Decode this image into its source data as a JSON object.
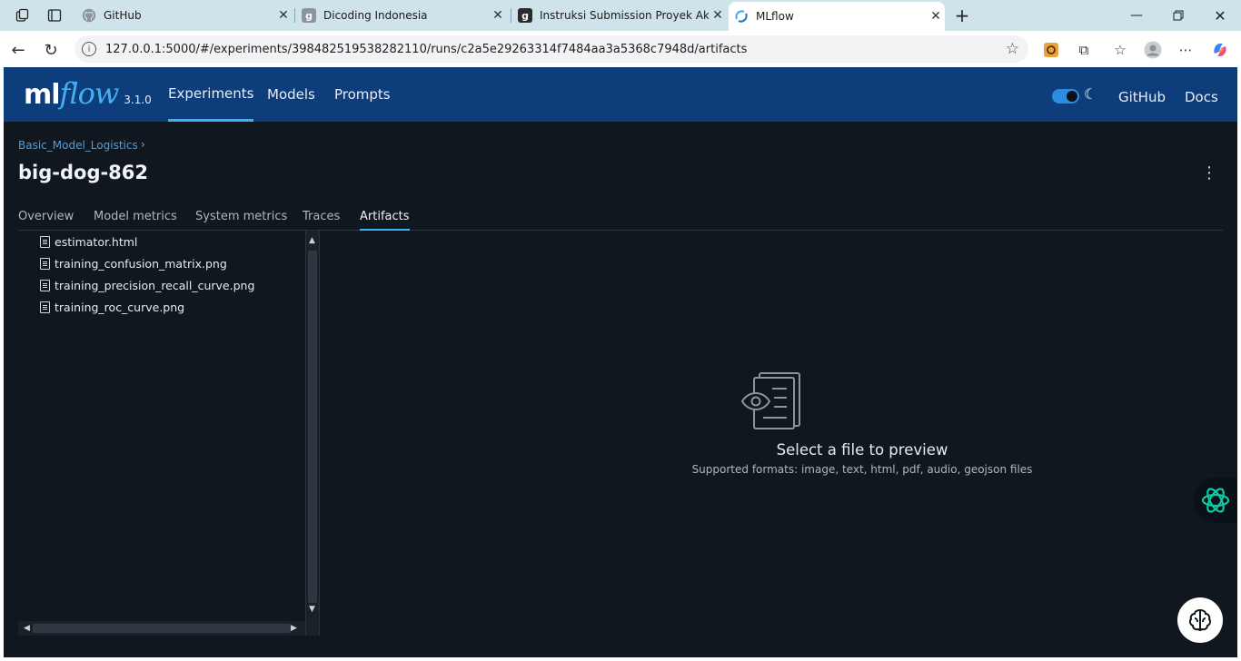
{
  "browser": {
    "tabs": [
      {
        "title": "GitHub",
        "favicon": "github-icon"
      },
      {
        "title": "Dicoding Indonesia",
        "favicon": "dicoding-icon"
      },
      {
        "title": "Instruksi Submission Proyek Akhir",
        "favicon": "dicoding-icon"
      },
      {
        "title": "MLflow",
        "favicon": "mlflow-icon",
        "active": true
      }
    ],
    "url": "127.0.0.1:5000/#/experiments/398482519538282110/runs/c2a5e29263314f7484aa3a5368c7948d/artifacts"
  },
  "app": {
    "logo_ml": "ml",
    "logo_flow": "flow",
    "version": "3.1.0",
    "nav": [
      "Experiments",
      "Models",
      "Prompts"
    ],
    "active_nav": "Experiments",
    "header_links": [
      "GitHub",
      "Docs"
    ],
    "dark_mode": true
  },
  "run": {
    "breadcrumb": "Basic_Model_Logistics",
    "breadcrumb_sep": "›",
    "title": "big-dog-862",
    "tabs": [
      "Overview",
      "Model metrics",
      "System metrics",
      "Traces",
      "Artifacts"
    ],
    "active_tab": "Artifacts"
  },
  "artifacts": {
    "files": [
      "estimator.html",
      "training_confusion_matrix.png",
      "training_precision_recall_curve.png",
      "training_roc_curve.png"
    ],
    "empty_title": "Select a file to preview",
    "empty_subtitle": "Supported formats: image, text, html, pdf, audio, geojson files"
  },
  "colors": {
    "header_bg": "#0e3d7c",
    "accent": "#43b0f1",
    "page_bg": "#11171f",
    "link": "#4d9fe0"
  }
}
